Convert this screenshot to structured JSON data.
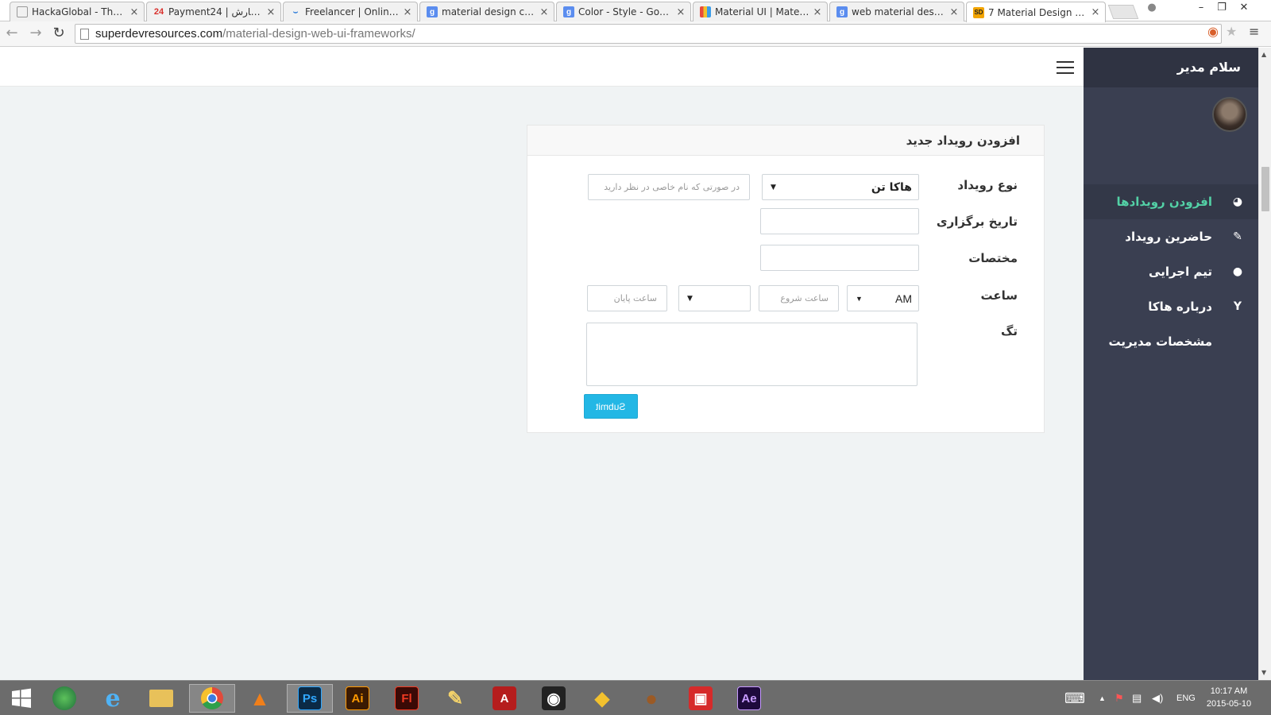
{
  "browser": {
    "tabs": [
      {
        "title": "HackaGlobal - The bigg",
        "favicon": "page-icon",
        "color": "#ffffff"
      },
      {
        "title": "Payment24 | سفارش",
        "favicon": "payment24-icon",
        "color": "#d9302c"
      },
      {
        "title": "Freelancer | Online Job",
        "favicon": "freelancer-icon",
        "color": "#2c7bd9"
      },
      {
        "title": "material design colors",
        "favicon": "google-icon",
        "color": "#5b8def"
      },
      {
        "title": "Color - Style - Google",
        "favicon": "google-icon",
        "color": "#5b8def"
      },
      {
        "title": "Material UI | Material D",
        "favicon": "materialui-icon",
        "color": "#e9a23b"
      },
      {
        "title": "web material design -",
        "favicon": "google-icon",
        "color": "#5b8def"
      },
      {
        "title": "7 Material Design Web",
        "favicon": "sd-icon",
        "color": "#f2a400",
        "active": true
      }
    ],
    "url_host": "superdevresources.com",
    "url_path": "/material-design-web-ui-frameworks/"
  },
  "header": {
    "greeting": "سلام  مدیر"
  },
  "sidebar": {
    "items": [
      {
        "label": "افزودن رویدادها",
        "icon": "dashboard-icon",
        "glyph": "◕",
        "active": true
      },
      {
        "label": "حاضرین رویداد",
        "icon": "gavel-icon",
        "glyph": "✎"
      },
      {
        "label": "تیم اجرایی",
        "icon": "globe-icon",
        "glyph": "●"
      },
      {
        "label": "درباره هاکا",
        "icon": "glass-icon",
        "glyph": "Y"
      },
      {
        "label": "مشخصات مدیریت",
        "icon": "",
        "glyph": ""
      }
    ]
  },
  "form": {
    "title": "افزودن رویداد جدید",
    "event_type_label": "نوع رویداد",
    "event_type_value": "هاکا تن",
    "custom_name_placeholder": "در صورتی که نام خاصی در نظر دارید",
    "date_label": "تاریخ برگزاری",
    "details_label": "مختصات",
    "time_label": "ساعت",
    "ampm_value": "AM",
    "start_time_placeholder": "ساعت شروع",
    "end_time_placeholder": "ساعت پایان",
    "end_ampm_value": "",
    "tag_label": "تگ",
    "submit_label": "Submit"
  },
  "taskbar": {
    "apps": [
      {
        "name": "windows-start-icon",
        "label": "",
        "bg": "transparent",
        "fg": "#ffffff"
      },
      {
        "name": "idm-icon",
        "label": "",
        "bg": "#2e8b3d",
        "fg": "#ffffff"
      },
      {
        "name": "internet-explorer-icon",
        "label": "e",
        "bg": "transparent",
        "fg": "#4fb3f6"
      },
      {
        "name": "file-explorer-icon",
        "label": "",
        "bg": "#e8c15a",
        "fg": "#ffffff"
      },
      {
        "name": "chrome-icon",
        "label": "",
        "bg": "#e24a3b",
        "fg": "#ffffff",
        "pressed": true
      },
      {
        "name": "vlc-icon",
        "label": "▲",
        "bg": "transparent",
        "fg": "#f07f1a"
      },
      {
        "name": "photoshop-icon",
        "label": "Ps",
        "bg": "#0b2a45",
        "fg": "#31a8ff",
        "pressed": true
      },
      {
        "name": "illustrator-icon",
        "label": "Ai",
        "bg": "#3a1a03",
        "fg": "#ff9a00"
      },
      {
        "name": "flash-icon",
        "label": "Fl",
        "bg": "#3a0a06",
        "fg": "#f13a22"
      },
      {
        "name": "brush-app-icon",
        "label": "✎",
        "bg": "transparent",
        "fg": "#f3d26a"
      },
      {
        "name": "autocad-icon",
        "label": "A",
        "bg": "#b51d1d",
        "fg": "#ffffff"
      },
      {
        "name": "app-dark-icon",
        "label": "◉",
        "bg": "#222222",
        "fg": "#ffffff"
      },
      {
        "name": "app-color-icon",
        "label": "◆",
        "bg": "transparent",
        "fg": "#f2c12e"
      },
      {
        "name": "app-round-icon",
        "label": "●",
        "bg": "transparent",
        "fg": "#9b5a25"
      },
      {
        "name": "sketchup-icon",
        "label": "▣",
        "bg": "#d62a2a",
        "fg": "#ffffff"
      },
      {
        "name": "after-effects-icon",
        "label": "Ae",
        "bg": "#1e0a3c",
        "fg": "#c79cff"
      }
    ],
    "language": "ENG",
    "time": "10:17 AM",
    "date": "2015-05-10"
  }
}
